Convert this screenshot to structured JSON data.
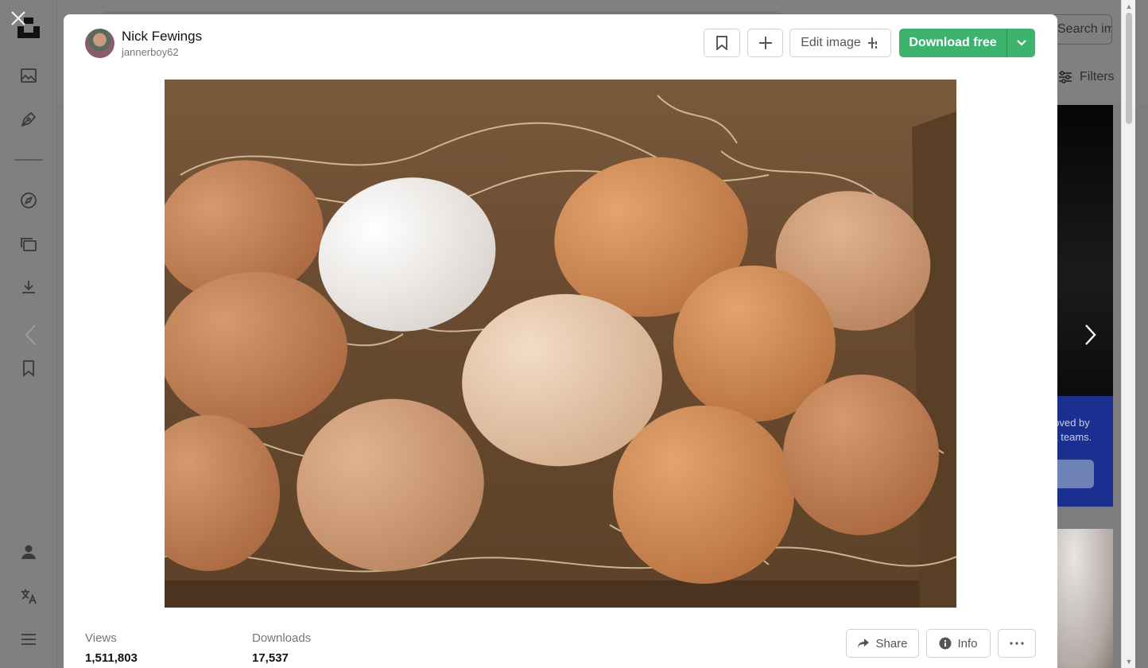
{
  "background": {
    "search_submit_label": "Search image",
    "filters_label": "Filters",
    "promo_line1": "Loved by",
    "promo_line2": "& teams."
  },
  "sidebar_icons": [
    "close-icon",
    "unsplash-logo",
    "image-icon",
    "pen-nib-icon",
    "compass-icon",
    "collections-icon",
    "download-icon",
    "bookmark-icon",
    "user-icon",
    "language-icon",
    "menu-icon"
  ],
  "modal": {
    "author": {
      "name": "Nick Fewings",
      "handle": "jannerboy62"
    },
    "toolbar": {
      "edit_label": "Edit image",
      "download_label": "Download free"
    },
    "photo": {
      "subject": "eggs in a wooden crate with straw"
    },
    "stats": {
      "views_label": "Views",
      "views_value": "1,511,803",
      "downloads_label": "Downloads",
      "downloads_value": "17,537"
    },
    "actions": {
      "share_label": "Share",
      "info_label": "Info"
    }
  },
  "colors": {
    "accent_green": "#3cb46e",
    "overlay": "#7d7d7d",
    "promo_blue": "#1a2f8f"
  }
}
